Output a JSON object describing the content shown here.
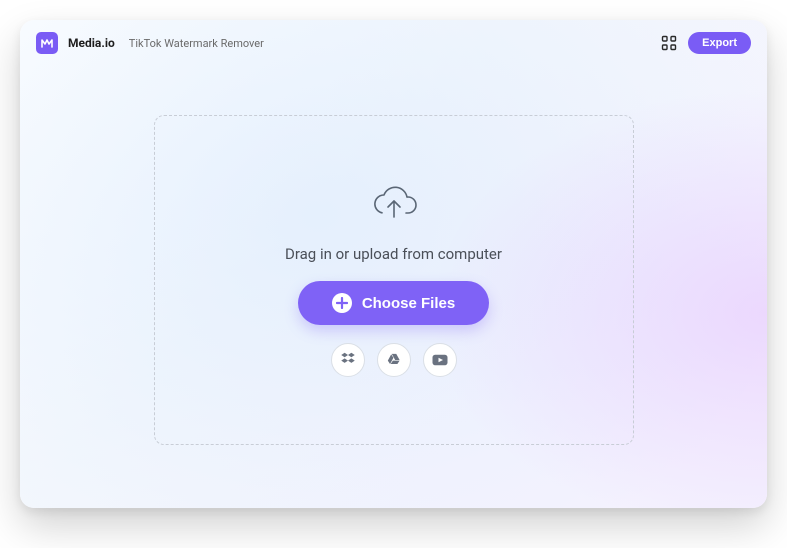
{
  "header": {
    "brand": "Media.io",
    "page_title": "TikTok Watermark Remover",
    "export_label": "Export"
  },
  "drop": {
    "prompt": "Drag in or upload from computer",
    "choose_label": "Choose Files"
  },
  "sources": {
    "dropbox": "Dropbox",
    "gdrive": "Google Drive",
    "youtube": "YouTube"
  },
  "colors": {
    "accent": "#7a5cf5"
  }
}
